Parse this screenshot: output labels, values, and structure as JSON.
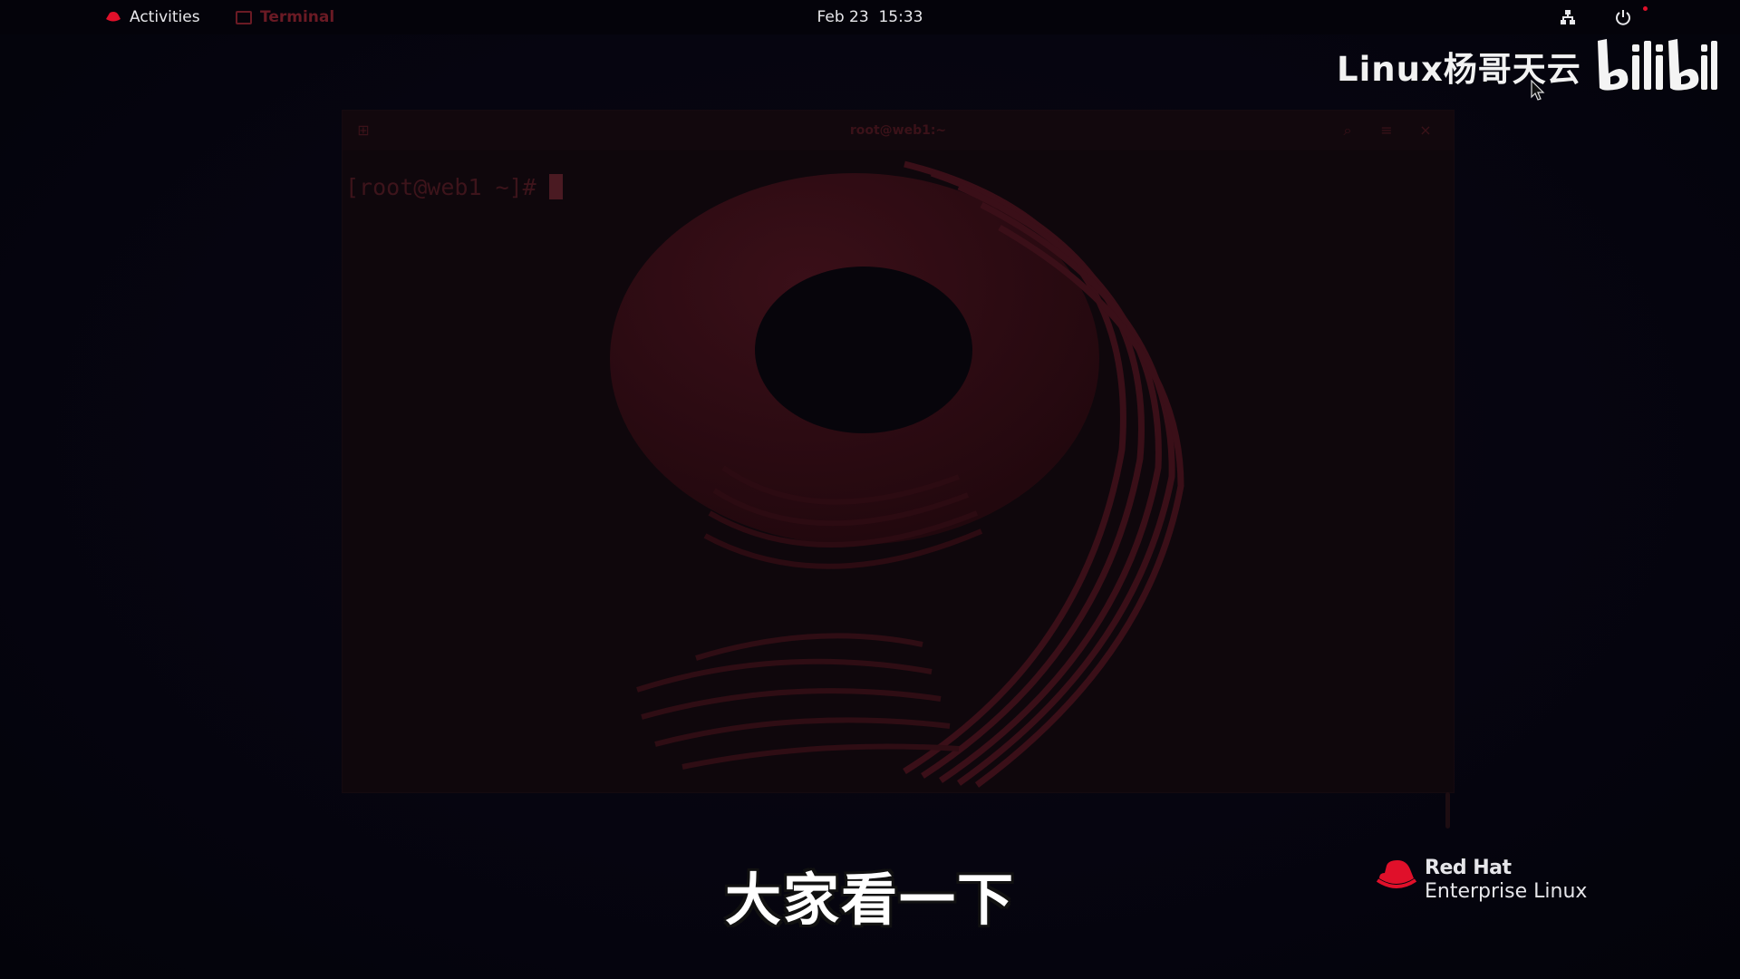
{
  "topbar": {
    "activities_label": "Activities",
    "app_label": "Terminal",
    "clock": "Feb 23  15:33"
  },
  "watermark": {
    "text": "Linux杨哥天云",
    "logo_text": "bilibili"
  },
  "terminal": {
    "title": "root@web1:~",
    "prompt": "[root@web1 ~]#",
    "wallpaper_glyph": "9"
  },
  "subtitle": "大家看一下",
  "branding": {
    "line1": "Red Hat",
    "line2": "Enterprise Linux"
  },
  "colors": {
    "accent_red": "#e0102a",
    "desktop_bg": "#05040d",
    "terminal_bg": "#0f070c"
  },
  "icons": [
    "redhat-icon",
    "terminal-icon",
    "network-icon",
    "power-icon",
    "mouse-cursor-icon",
    "new-tab-icon",
    "search-icon",
    "menu-icon",
    "close-icon"
  ]
}
